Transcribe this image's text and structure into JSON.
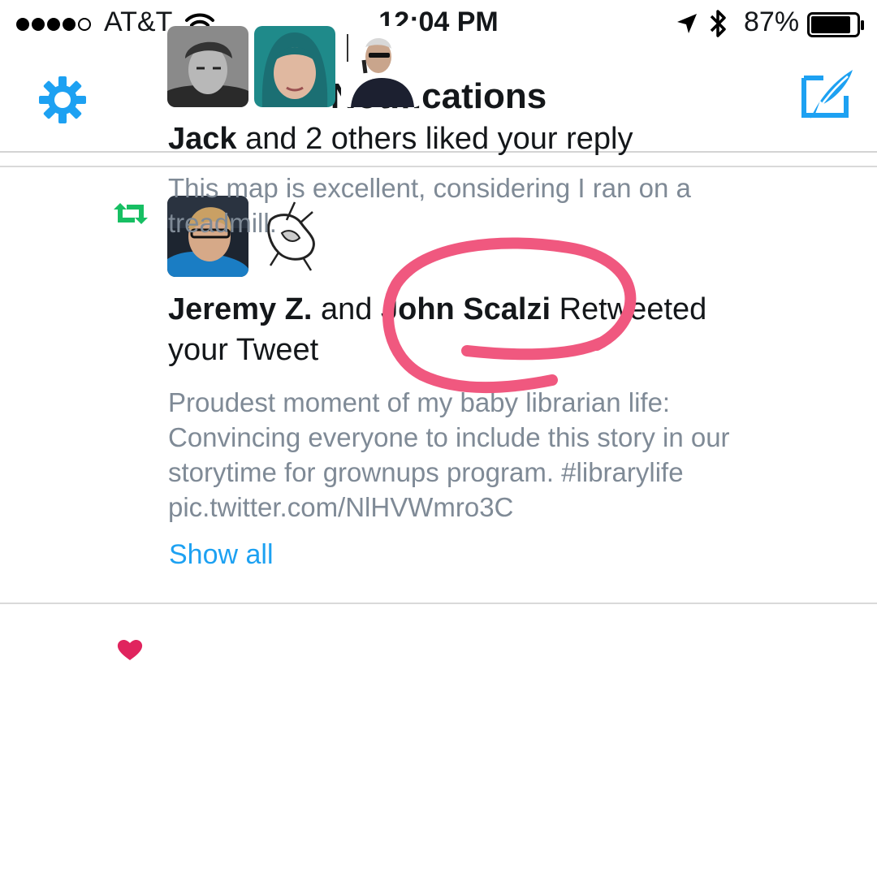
{
  "status_bar": {
    "carrier": "AT&T",
    "time": "12:04 PM",
    "battery": "87%",
    "battery_level": 0.87,
    "signal_bars": 4,
    "signal_max": 5
  },
  "nav": {
    "title": "Notifications",
    "left_icon": "gear-icon",
    "right_icon": "compose-icon",
    "accent_color": "#1da1f2"
  },
  "notifications": [
    {
      "type": "retweet",
      "icon": "retweet-icon",
      "icon_color": "#17bf63",
      "actors": [
        "Jeremy Z.",
        "John Scalzi"
      ],
      "connector": "and",
      "action_line": "Retweeted",
      "action_line2": "your Tweet",
      "tweet": "Proudest moment of my baby librarian life: Convincing everyone to include this story in our storytime for grownups program. #librarylife pic.twitter.com/NlHVWmro3C",
      "tweet_lines": [
        "Proudest moment of my baby librarian life:",
        "Convincing everyone to include this story in our",
        "storytime for grownups program. #librarylife",
        "pic.twitter.com/NlHVWmro3C"
      ],
      "show_all": "Show all"
    },
    {
      "type": "like",
      "icon": "heart-icon",
      "icon_color": "#e0245e",
      "actor": "Jack",
      "action": "and 2 others liked your reply",
      "tweet_lines": [
        "This map is excellent, considering I ran on a",
        "treadmill."
      ]
    }
  ],
  "annotation": {
    "color": "#f0587f"
  }
}
